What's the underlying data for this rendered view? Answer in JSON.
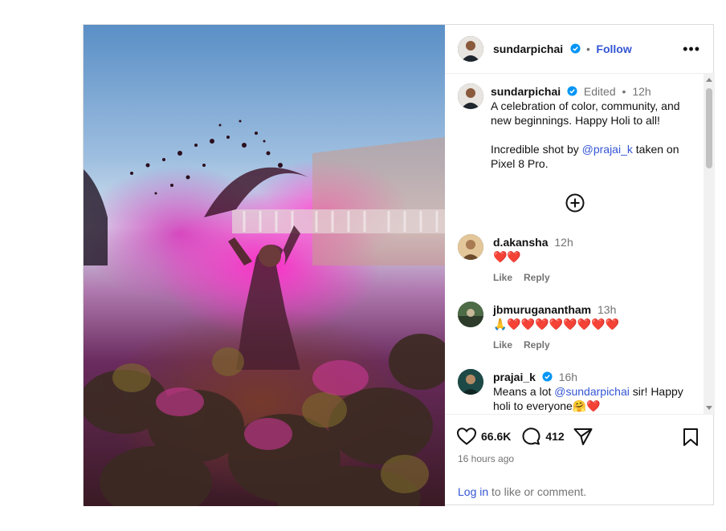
{
  "post": {
    "author": "sundarpichai",
    "follow_label": "Follow",
    "separator": "•",
    "more_glyph": "•••"
  },
  "caption": {
    "author": "sundarpichai",
    "edited": "Edited",
    "separator": "•",
    "time": "12h",
    "line1": "A celebration of color, community, and new beginnings. Happy Holi to all!",
    "line2_prefix": "Incredible shot by ",
    "line2_mention": "@prajai_k",
    "line2_suffix": " taken on Pixel 8 Pro."
  },
  "load_more_icon": "plus-circle-icon",
  "comments": [
    {
      "user": "d.akansha",
      "time": "12h",
      "text": "❤️❤️",
      "like": "Like",
      "reply": "Reply"
    },
    {
      "user": "jbmuruganantham",
      "time": "13h",
      "text": "🙏❤️❤️❤️❤️❤️❤️❤️❤️",
      "like": "Like",
      "reply": "Reply"
    },
    {
      "user": "prajai_k",
      "time": "16h",
      "text_prefix": "Means a lot ",
      "text_mention": "@sundarpichai",
      "text_suffix": " sir! Happy holi to everyone🤗❤️"
    }
  ],
  "stats": {
    "likes": "66.6K",
    "comments": "412",
    "posted": "16 hours ago"
  },
  "login": {
    "link": "Log in",
    "text": " to like or comment."
  },
  "colors": {
    "accent": "#3455d4",
    "verified": "#0095f6",
    "heart": "#e2262c"
  }
}
